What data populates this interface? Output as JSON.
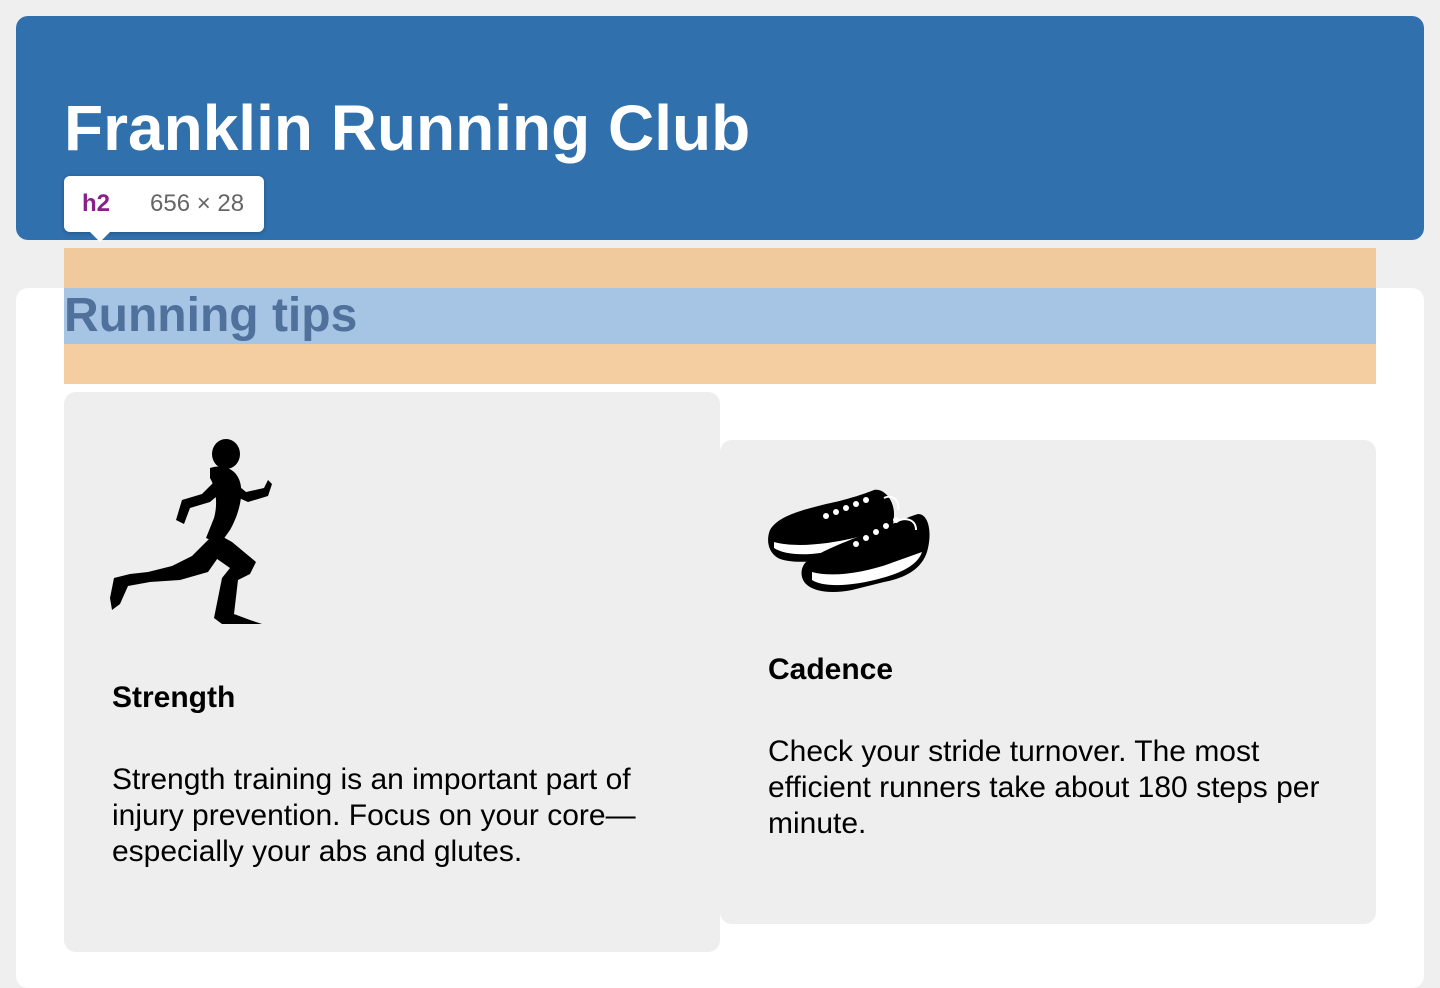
{
  "header": {
    "title": "Franklin Running Club",
    "background": "#3070ad"
  },
  "devtools_tooltip": {
    "tag": "h2",
    "dimensions": "656 × 28"
  },
  "section": {
    "title": "Running tips"
  },
  "cards": [
    {
      "icon": "runner-silhouette-icon",
      "title": "Strength",
      "text": "Strength training is an important part of injury prevention. Focus on your core—especially your abs and glutes."
    },
    {
      "icon": "running-shoes-icon",
      "title": "Cadence",
      "text": "Check your stride turnover. The most efficient runners take about 180 steps per minute."
    }
  ]
}
